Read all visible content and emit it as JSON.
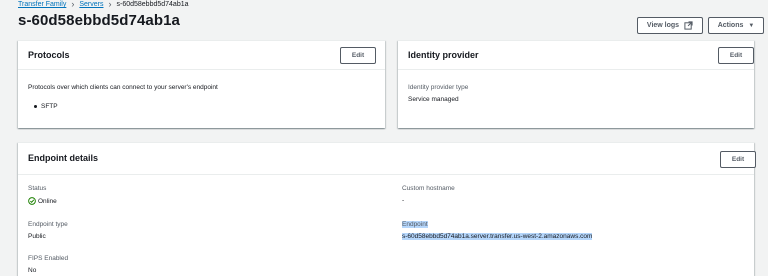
{
  "breadcrumb": {
    "items": [
      "Transfer Family",
      "Servers"
    ],
    "current": "s-60d58ebbd5d74ab1a"
  },
  "page": {
    "title": "s-60d58ebbd5d74ab1a",
    "view_logs_label": "View logs",
    "actions_label": "Actions"
  },
  "protocols": {
    "title": "Protocols",
    "edit_label": "Edit",
    "description": "Protocols over which clients can connect to your server's endpoint",
    "items": [
      "SFTP"
    ]
  },
  "identity": {
    "title": "Identity provider",
    "edit_label": "Edit",
    "type_label": "Identity provider type",
    "type_value": "Service managed"
  },
  "endpoint": {
    "title": "Endpoint details",
    "edit_label": "Edit",
    "status_label": "Status",
    "status_value": "Online",
    "type_label": "Endpoint type",
    "type_value": "Public",
    "fips_label": "FIPS Enabled",
    "fips_value": "No",
    "hostname_label": "Custom hostname",
    "hostname_value": "-",
    "endpoint_label": "Endpoint",
    "endpoint_value": "s-60d58ebbd5d74ab1a.server.transfer.us-west-2.amazonaws.com"
  },
  "colors": {
    "link": "#0073bb",
    "success": "#1d8102",
    "selection": "#b5d6fb"
  },
  "icons": {
    "external": "external-link-icon",
    "caret": "caret-down-icon",
    "status": "status-check-icon"
  }
}
